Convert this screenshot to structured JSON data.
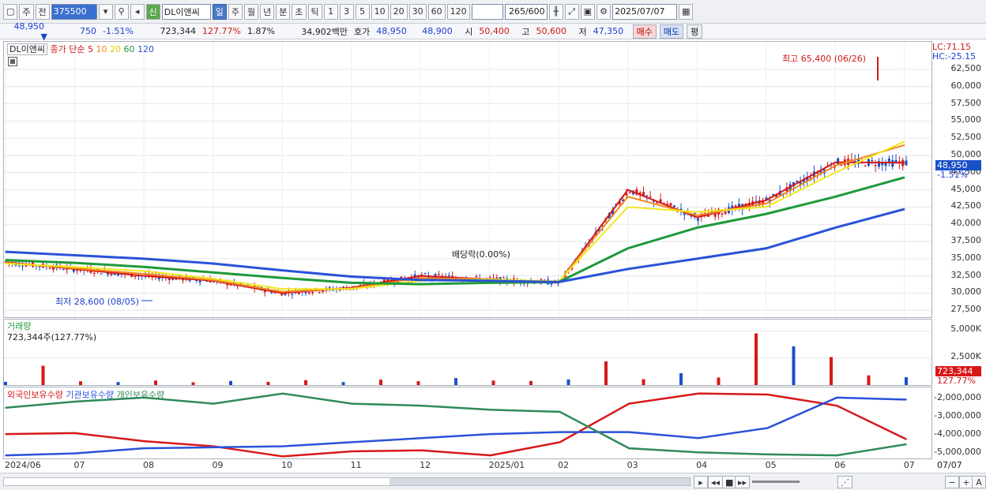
{
  "toolbar": {
    "market": "주",
    "prev": "전",
    "code": "375500",
    "badge": "신",
    "name": "DL이앤씨",
    "periods": [
      "일",
      "주",
      "월",
      "년",
      "분",
      "초",
      "틱"
    ],
    "active_period": "일",
    "intervals": [
      "1",
      "3",
      "5",
      "10",
      "20",
      "30",
      "60",
      "120"
    ],
    "count": "265",
    "count_total": "/600",
    "date": "2025/07/07"
  },
  "quote": {
    "price": "48,950",
    "change": "750",
    "change_pct": "-1.51%",
    "volume": "723,344",
    "volume_ratio": "127.77%",
    "turnover": "1.87%",
    "amount": "34,902백만",
    "bid_label": "호가",
    "ask": "48,950",
    "bid": "48,900",
    "open_label": "시",
    "open": "50,400",
    "high_label": "고",
    "high": "50,600",
    "low_label": "저",
    "low": "47,350",
    "buy": "매수",
    "sell": "매도",
    "eval": "평"
  },
  "price_panel": {
    "name_tag": "DL이앤씨",
    "legend": {
      "label": "종가 단순",
      "ma": [
        {
          "period": "5",
          "color": "#d81818"
        },
        {
          "period": "10",
          "color": "#f08a1c"
        },
        {
          "period": "20",
          "color": "#f0e820"
        },
        {
          "period": "60",
          "color": "#1e9a3a"
        },
        {
          "period": "120",
          "color": "#2a52d8"
        }
      ]
    },
    "lc": "LC:71.15",
    "hc": "HC:-25.15",
    "high_annotation": "최고 65,400 (06/26)",
    "low_annotation": "최저 28,600 (08/05)",
    "dividend_annotation": "배당락(0.00%)",
    "current_price": "48,950",
    "current_change": "-1.51%",
    "yticks": [
      "62,500",
      "60,000",
      "57,500",
      "55,000",
      "52,500",
      "50,000",
      "47,500",
      "45,000",
      "42,500",
      "40,000",
      "37,500",
      "35,000",
      "32,500",
      "30,000",
      "27,500"
    ]
  },
  "volume_panel": {
    "title": "거래량",
    "value": "723,344주(127.77%)",
    "yticks": [
      "5,000K",
      "2,500K"
    ],
    "current_volume": "723,344",
    "current_ratio": "127.77%"
  },
  "holding_panel": {
    "series": [
      {
        "name": "외국인보유수량",
        "color": "#d81818"
      },
      {
        "name": "기관보유수량",
        "color": "#2a52d8"
      },
      {
        "name": "개인보유수량",
        "color": "#2f8a5a"
      }
    ],
    "yticks": [
      "-2,000,000",
      "-3,000,000",
      "-4,000,000",
      "-5,000,000"
    ]
  },
  "xaxis": {
    "labels": [
      "2024/06",
      "07",
      "08",
      "09",
      "10",
      "11",
      "12",
      "2025/01",
      "02",
      "03",
      "04",
      "05",
      "06",
      "07"
    ],
    "right_label": "07/07"
  },
  "colors": {
    "up": "#d81818",
    "down": "#1a50c8",
    "accent": "#3a6fd0"
  },
  "chart_data": [
    {
      "type": "line",
      "title": "DL이앤씨",
      "x": [
        "2024/06",
        "07",
        "08",
        "09",
        "10",
        "11",
        "12",
        "2025/01",
        "02",
        "03",
        "04",
        "05",
        "06",
        "07"
      ],
      "series": [
        {
          "name": "5",
          "values": [
            34500,
            33500,
            32500,
            31800,
            30000,
            30800,
            32500,
            32000,
            31500,
            45000,
            41000,
            43500,
            49000,
            48950
          ]
        },
        {
          "name": "10",
          "values": [
            34400,
            33600,
            32800,
            31900,
            30200,
            30700,
            32200,
            32000,
            31600,
            44000,
            41300,
            43000,
            48500,
            51500
          ]
        },
        {
          "name": "20",
          "values": [
            34300,
            33800,
            33200,
            32100,
            30600,
            30600,
            31800,
            32000,
            31700,
            42500,
            41800,
            42500,
            47500,
            52000
          ]
        },
        {
          "name": "60",
          "values": [
            34800,
            34400,
            33800,
            33000,
            32200,
            31500,
            31300,
            31500,
            31600,
            36500,
            39500,
            41500,
            44000,
            46800
          ]
        },
        {
          "name": "120",
          "values": [
            36000,
            35500,
            35000,
            34300,
            33300,
            32400,
            31900,
            31800,
            31600,
            33500,
            35000,
            36500,
            39500,
            42200
          ]
        }
      ],
      "ylim": [
        26500,
        66500
      ],
      "annotations": [
        "최고 65,400 (06/26)",
        "최저 28,600 (08/05)",
        "배당락(0.00%)"
      ]
    },
    {
      "type": "bar",
      "title": "거래량",
      "series": [
        {
          "name": "거래량",
          "values": [
            300,
            1800,
            350,
            280,
            420,
            260,
            380,
            300,
            450,
            280,
            500,
            360,
            650,
            420,
            380,
            520,
            2200,
            550,
            1100,
            700,
            4800,
            3600,
            2600,
            900,
            723
          ]
        }
      ],
      "ylim": [
        0,
        5500
      ]
    },
    {
      "type": "line",
      "x": [
        "2024/06",
        "07",
        "08",
        "09",
        "10",
        "11",
        "12",
        "2025/01",
        "02",
        "03",
        "04",
        "05",
        "06",
        "07"
      ],
      "series": [
        {
          "name": "외국인보유수량",
          "values": [
            -4100000,
            -4050000,
            -4450000,
            -4700000,
            -5200000,
            -4950000,
            -4900000,
            -5150000,
            -4500000,
            -2600000,
            -2100000,
            -2150000,
            -2700000,
            -4350000
          ]
        },
        {
          "name": "기관보유수량",
          "values": [
            -5150000,
            -5050000,
            -4800000,
            -4750000,
            -4700000,
            -4500000,
            -4300000,
            -4100000,
            -4000000,
            -4000000,
            -4300000,
            -3800000,
            -2300000,
            -2400000
          ]
        },
        {
          "name": "개인보유수량",
          "values": [
            -2800000,
            -2500000,
            -2300000,
            -2600000,
            -2100000,
            -2600000,
            -2700000,
            -2900000,
            -3000000,
            -4800000,
            -5000000,
            -5100000,
            -5150000,
            -4600000
          ]
        }
      ],
      "ylim": [
        -5300000,
        -1800000
      ]
    }
  ]
}
